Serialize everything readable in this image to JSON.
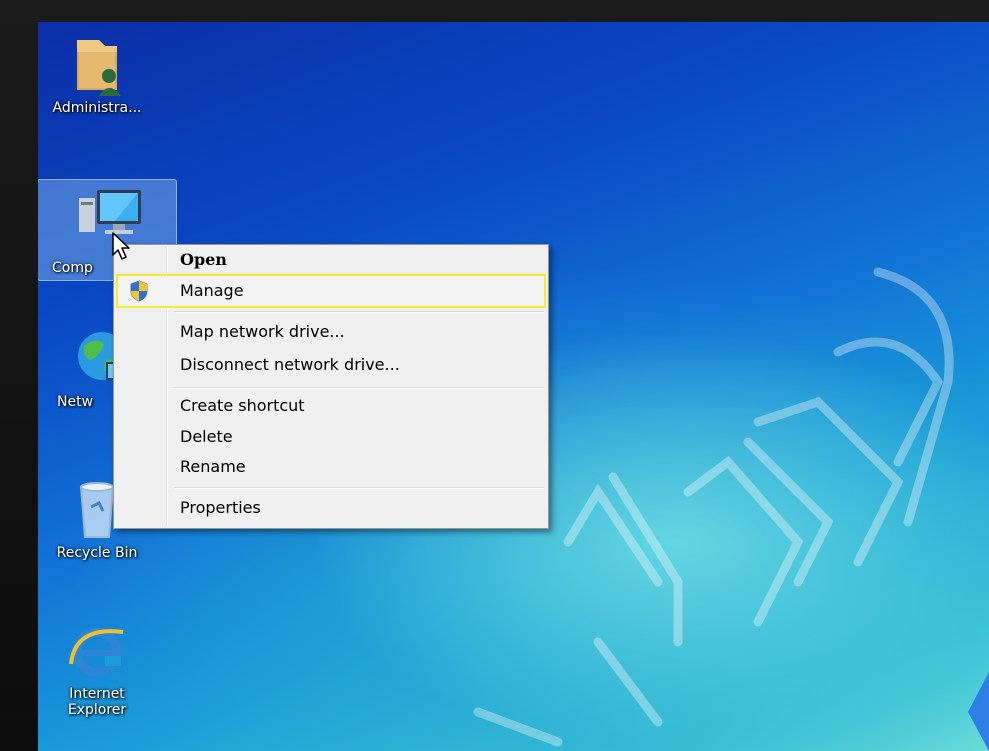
{
  "desktop": {
    "icons": [
      {
        "label": "Administra...",
        "icon": "user-folder-icon"
      },
      {
        "label": "Comp",
        "icon": "computer-icon"
      },
      {
        "label": "Netw",
        "icon": "network-icon"
      },
      {
        "label": "Recycle Bin",
        "icon": "recycle-bin-icon"
      },
      {
        "label": "Internet Explorer",
        "icon": "internet-explorer-icon"
      }
    ]
  },
  "context_menu": {
    "items": [
      {
        "label": "Open",
        "bold": true
      },
      {
        "label": "Manage",
        "icon": "uac-shield-icon",
        "highlighted": true,
        "highlight_color": "#f3ef2c"
      },
      {
        "label": "Map network drive..."
      },
      {
        "label": "Disconnect network drive..."
      },
      {
        "label": "Create shortcut"
      },
      {
        "label": "Delete"
      },
      {
        "label": "Rename"
      },
      {
        "label": "Properties"
      }
    ]
  },
  "colors": {
    "desktop_top": "#0b2fa8",
    "desktop_bottom": "#6fe0da",
    "menu_bg": "#f0f0f0",
    "highlight_border": "#f3ef2c"
  }
}
